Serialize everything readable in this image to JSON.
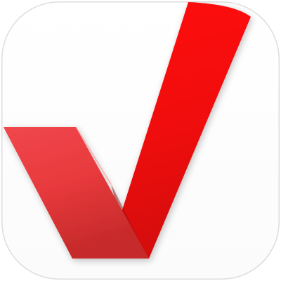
{
  "app_icon": {
    "symbol": "checkmark-icon",
    "background_color": "#ffffff",
    "border_color": "#dddddd",
    "colors": {
      "bright_red": "#ff0a0a",
      "red": "#e81414",
      "dark_red": "#a01414",
      "short_stroke_light": "#f0474d",
      "short_stroke_mid": "#e83a3d",
      "short_stroke_dark": "#c62a2a"
    }
  }
}
